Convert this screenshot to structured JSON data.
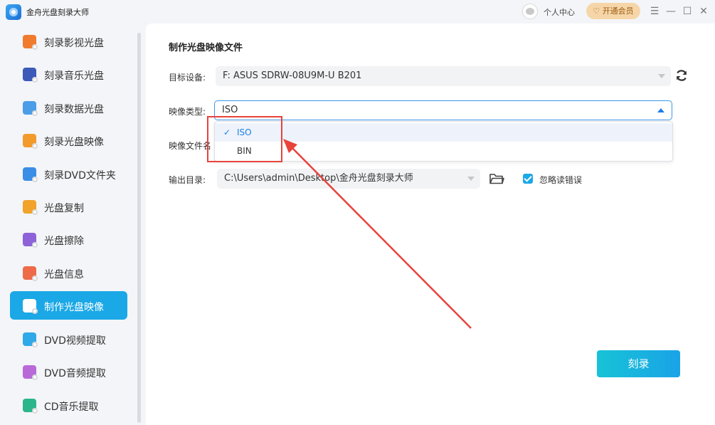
{
  "titlebar": {
    "app_title": "金舟光盘刻录大师",
    "user_center": "个人中心",
    "vip_label": "开通会员",
    "menu_glyph": "☰",
    "minimize_glyph": "—",
    "maximize_glyph": "☐",
    "close_glyph": "✕"
  },
  "sidebar": {
    "items": [
      {
        "label": "刻录影视光盘",
        "icon": "video-disc-icon",
        "color": "#f07a2e"
      },
      {
        "label": "刻录音乐光盘",
        "icon": "music-disc-icon",
        "color": "#3d5ab8"
      },
      {
        "label": "刻录数据光盘",
        "icon": "data-disc-icon",
        "color": "#4b9de8"
      },
      {
        "label": "刻录光盘映像",
        "icon": "image-disc-icon",
        "color": "#f29b2c"
      },
      {
        "label": "刻录DVD文件夹",
        "icon": "dvd-folder-icon",
        "color": "#3a8ee6"
      },
      {
        "label": "光盘复制",
        "icon": "disc-copy-icon",
        "color": "#f1a32a"
      },
      {
        "label": "光盘擦除",
        "icon": "disc-erase-icon",
        "color": "#8e63d9"
      },
      {
        "label": "光盘信息",
        "icon": "disc-info-icon",
        "color": "#ee6b4a"
      },
      {
        "label": "制作光盘映像",
        "icon": "make-image-icon",
        "color": "#ffffff"
      },
      {
        "label": "DVD视频提取",
        "icon": "dvd-video-extract-icon",
        "color": "#2fa9e8"
      },
      {
        "label": "DVD音频提取",
        "icon": "dvd-audio-extract-icon",
        "color": "#b86ad8"
      },
      {
        "label": "CD音乐提取",
        "icon": "cd-music-extract-icon",
        "color": "#2bb58a"
      }
    ],
    "active_index": 8
  },
  "main": {
    "section_title": "制作光盘映像文件",
    "target_device_label": "目标设备:",
    "target_device_value": "F: ASUS SDRW-08U9M-U B201",
    "image_type_label": "映像类型:",
    "image_type_value": "ISO",
    "image_name_label": "映像文件名",
    "output_dir_label": "输出目录:",
    "output_dir_value": "C:\\Users\\admin\\Desktop\\金舟光盘刻录大师",
    "ignore_errors_label": "忽略读错误",
    "ignore_errors_checked": true,
    "burn_button": "刻录"
  },
  "dropdown": {
    "options": [
      {
        "label": "ISO",
        "selected": true
      },
      {
        "label": "BIN",
        "selected": false
      }
    ],
    "check_glyph": "✓"
  },
  "colors": {
    "accent": "#1ba8e6",
    "annotation": "#e8433b"
  }
}
